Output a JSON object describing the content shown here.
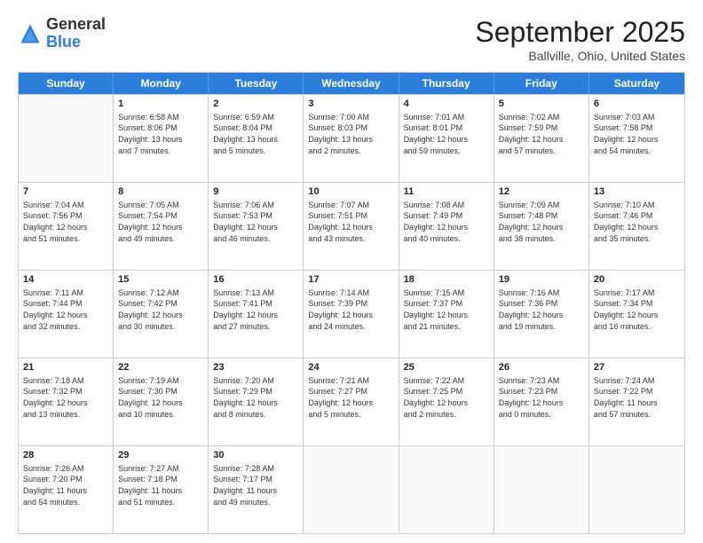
{
  "header": {
    "logo_general": "General",
    "logo_blue": "Blue",
    "month_title": "September 2025",
    "location": "Ballville, Ohio, United States"
  },
  "weekdays": [
    "Sunday",
    "Monday",
    "Tuesday",
    "Wednesday",
    "Thursday",
    "Friday",
    "Saturday"
  ],
  "rows": [
    [
      {
        "day": "",
        "info": ""
      },
      {
        "day": "1",
        "info": "Sunrise: 6:58 AM\nSunset: 8:06 PM\nDaylight: 13 hours\nand 7 minutes."
      },
      {
        "day": "2",
        "info": "Sunrise: 6:59 AM\nSunset: 8:04 PM\nDaylight: 13 hours\nand 5 minutes."
      },
      {
        "day": "3",
        "info": "Sunrise: 7:00 AM\nSunset: 8:03 PM\nDaylight: 13 hours\nand 2 minutes."
      },
      {
        "day": "4",
        "info": "Sunrise: 7:01 AM\nSunset: 8:01 PM\nDaylight: 12 hours\nand 59 minutes."
      },
      {
        "day": "5",
        "info": "Sunrise: 7:02 AM\nSunset: 7:59 PM\nDaylight: 12 hours\nand 57 minutes."
      },
      {
        "day": "6",
        "info": "Sunrise: 7:03 AM\nSunset: 7:58 PM\nDaylight: 12 hours\nand 54 minutes."
      }
    ],
    [
      {
        "day": "7",
        "info": "Sunrise: 7:04 AM\nSunset: 7:56 PM\nDaylight: 12 hours\nand 51 minutes."
      },
      {
        "day": "8",
        "info": "Sunrise: 7:05 AM\nSunset: 7:54 PM\nDaylight: 12 hours\nand 49 minutes."
      },
      {
        "day": "9",
        "info": "Sunrise: 7:06 AM\nSunset: 7:53 PM\nDaylight: 12 hours\nand 46 minutes."
      },
      {
        "day": "10",
        "info": "Sunrise: 7:07 AM\nSunset: 7:51 PM\nDaylight: 12 hours\nand 43 minutes."
      },
      {
        "day": "11",
        "info": "Sunrise: 7:08 AM\nSunset: 7:49 PM\nDaylight: 12 hours\nand 40 minutes."
      },
      {
        "day": "12",
        "info": "Sunrise: 7:09 AM\nSunset: 7:48 PM\nDaylight: 12 hours\nand 38 minutes."
      },
      {
        "day": "13",
        "info": "Sunrise: 7:10 AM\nSunset: 7:46 PM\nDaylight: 12 hours\nand 35 minutes."
      }
    ],
    [
      {
        "day": "14",
        "info": "Sunrise: 7:11 AM\nSunset: 7:44 PM\nDaylight: 12 hours\nand 32 minutes."
      },
      {
        "day": "15",
        "info": "Sunrise: 7:12 AM\nSunset: 7:42 PM\nDaylight: 12 hours\nand 30 minutes."
      },
      {
        "day": "16",
        "info": "Sunrise: 7:13 AM\nSunset: 7:41 PM\nDaylight: 12 hours\nand 27 minutes."
      },
      {
        "day": "17",
        "info": "Sunrise: 7:14 AM\nSunset: 7:39 PM\nDaylight: 12 hours\nand 24 minutes."
      },
      {
        "day": "18",
        "info": "Sunrise: 7:15 AM\nSunset: 7:37 PM\nDaylight: 12 hours\nand 21 minutes."
      },
      {
        "day": "19",
        "info": "Sunrise: 7:16 AM\nSunset: 7:36 PM\nDaylight: 12 hours\nand 19 minutes."
      },
      {
        "day": "20",
        "info": "Sunrise: 7:17 AM\nSunset: 7:34 PM\nDaylight: 12 hours\nand 16 minutes."
      }
    ],
    [
      {
        "day": "21",
        "info": "Sunrise: 7:18 AM\nSunset: 7:32 PM\nDaylight: 12 hours\nand 13 minutes."
      },
      {
        "day": "22",
        "info": "Sunrise: 7:19 AM\nSunset: 7:30 PM\nDaylight: 12 hours\nand 10 minutes."
      },
      {
        "day": "23",
        "info": "Sunrise: 7:20 AM\nSunset: 7:29 PM\nDaylight: 12 hours\nand 8 minutes."
      },
      {
        "day": "24",
        "info": "Sunrise: 7:21 AM\nSunset: 7:27 PM\nDaylight: 12 hours\nand 5 minutes."
      },
      {
        "day": "25",
        "info": "Sunrise: 7:22 AM\nSunset: 7:25 PM\nDaylight: 12 hours\nand 2 minutes."
      },
      {
        "day": "26",
        "info": "Sunrise: 7:23 AM\nSunset: 7:23 PM\nDaylight: 12 hours\nand 0 minutes."
      },
      {
        "day": "27",
        "info": "Sunrise: 7:24 AM\nSunset: 7:22 PM\nDaylight: 11 hours\nand 57 minutes."
      }
    ],
    [
      {
        "day": "28",
        "info": "Sunrise: 7:26 AM\nSunset: 7:20 PM\nDaylight: 11 hours\nand 54 minutes."
      },
      {
        "day": "29",
        "info": "Sunrise: 7:27 AM\nSunset: 7:18 PM\nDaylight: 11 hours\nand 51 minutes."
      },
      {
        "day": "30",
        "info": "Sunrise: 7:28 AM\nSunset: 7:17 PM\nDaylight: 11 hours\nand 49 minutes."
      },
      {
        "day": "",
        "info": ""
      },
      {
        "day": "",
        "info": ""
      },
      {
        "day": "",
        "info": ""
      },
      {
        "day": "",
        "info": ""
      }
    ]
  ]
}
